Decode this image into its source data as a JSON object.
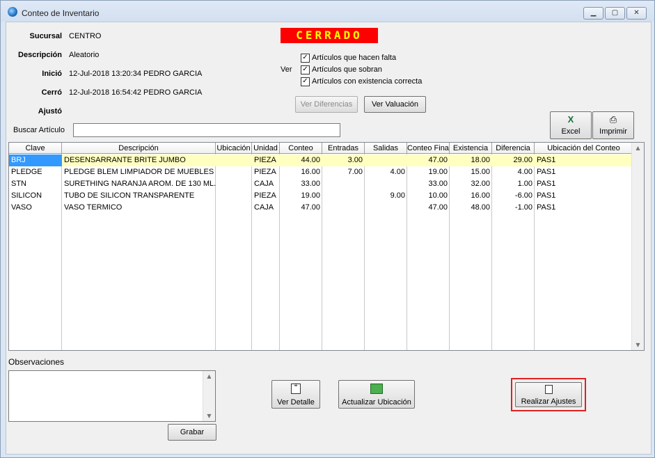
{
  "window": {
    "title": "Conteo de Inventario"
  },
  "header": {
    "sucursal_label": "Sucursal",
    "sucursal": "CENTRO",
    "descripcion_label": "Descripción",
    "descripcion": "Aleatorio",
    "inicio_label": "Inició",
    "inicio": "12-Jul-2018 13:20:34 PEDRO GARCIA",
    "cerro_label": "Cerró",
    "cerro": "12-Jul-2018 16:54:42 PEDRO GARCIA",
    "ajusto_label": "Ajustó",
    "ajusto": "",
    "status": "CERRADO"
  },
  "ver": {
    "label": "Ver",
    "options": [
      {
        "label": "Artículos que hacen falta",
        "checked": true
      },
      {
        "label": "Artículos que sobran",
        "checked": true
      },
      {
        "label": "Artículos con existencia correcta",
        "checked": true
      }
    ]
  },
  "buttons": {
    "ver_diferencias": "Ver Diferencias",
    "ver_valuacion": "Ver Valuación",
    "excel": "Excel",
    "imprimir": "Imprimir",
    "ver_detalle": "Ver Detalle",
    "actualizar_ubicacion": "Actualizar Ubicación",
    "realizar_ajustes": "Realizar Ajustes",
    "grabar": "Grabar"
  },
  "search": {
    "label": "Buscar Artículo",
    "value": ""
  },
  "grid": {
    "columns": [
      "Clave",
      "Descripción",
      "Ubicación",
      "Unidad",
      "Conteo",
      "Entradas",
      "Salidas",
      "Conteo Final",
      "Existencia",
      "Diferencia",
      "Ubicación del Conteo"
    ],
    "rows": [
      [
        "BRJ",
        "DESENSARRANTE BRITE JUMBO",
        "",
        "PIEZA",
        "44.00",
        "3.00",
        "",
        "47.00",
        "18.00",
        "29.00",
        "PAS1"
      ],
      [
        "PLEDGE",
        "PLEDGE BLEM  LIMPIADOR DE MUEBLES",
        "",
        "PIEZA",
        "16.00",
        "7.00",
        "4.00",
        "19.00",
        "15.00",
        "4.00",
        "PAS1"
      ],
      [
        "STN",
        "SURETHING  NARANJA AROM. DE 130 ML.",
        "",
        "CAJA",
        "33.00",
        "",
        "",
        "33.00",
        "32.00",
        "1.00",
        "PAS1"
      ],
      [
        "SILICON",
        "TUBO DE SILICON TRANSPARENTE",
        "",
        "PIEZA",
        "19.00",
        "",
        "9.00",
        "10.00",
        "16.00",
        "-6.00",
        "PAS1"
      ],
      [
        "VASO",
        "VASO TERMICO",
        "",
        "CAJA",
        "47.00",
        "",
        "",
        "47.00",
        "48.00",
        "-1.00",
        "PAS1"
      ]
    ]
  },
  "observaciones": {
    "label": "Observaciones",
    "value": ""
  },
  "colors": {
    "status_bg": "#ff0000",
    "status_fg": "#ffff00",
    "selected_row": "#ffffc0",
    "selected_key": "#3399ff",
    "highlight_frame": "#e02020"
  }
}
